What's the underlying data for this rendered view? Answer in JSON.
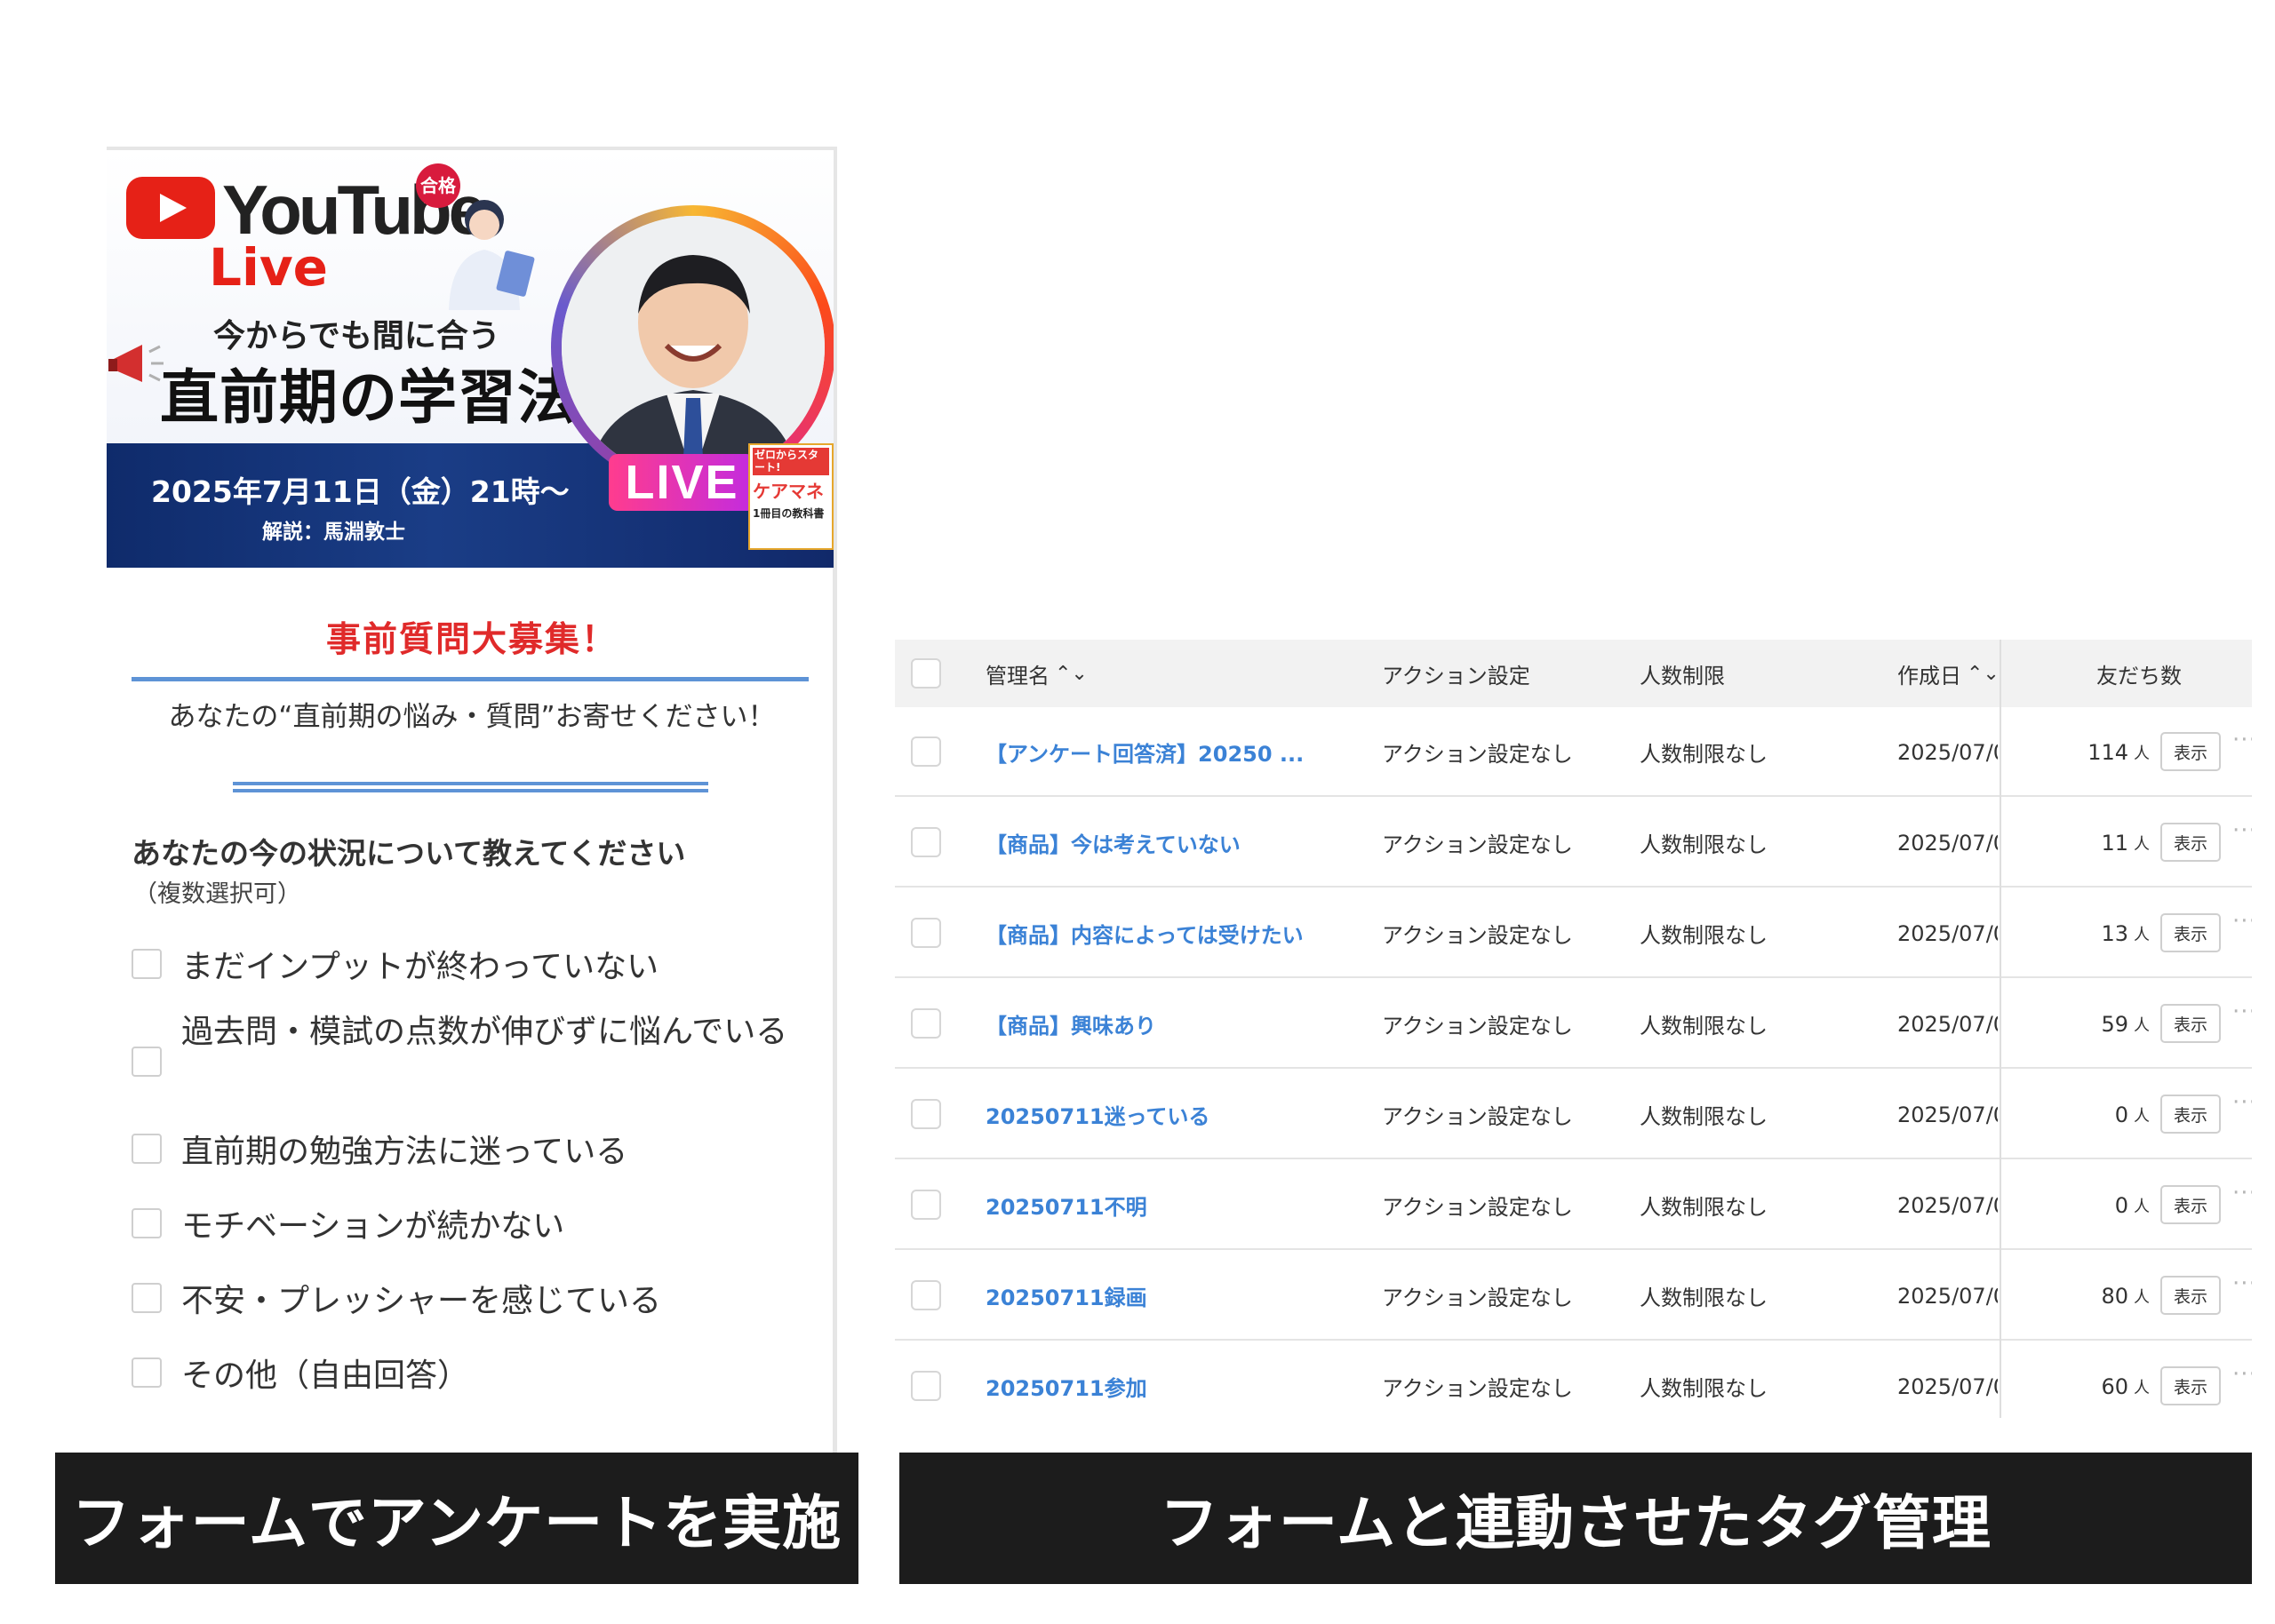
{
  "form": {
    "banner": {
      "youtube_word": "YouTube",
      "live_word": "Live",
      "pass_badge": "合格",
      "tagline": "今からでも間に合う",
      "headline": "直前期の学習法",
      "date": "2025年7月11日（金）21時〜",
      "speaker": "解説：馬淵敦士",
      "live_badge": "LIVE",
      "book_tag": "ゼロからスタート!",
      "book_title": "ケアマネ",
      "book_sub": "1冊目の教科書"
    },
    "section_title": "事前質問大募集！",
    "subtitle": "あなたの“直前期の悩み・質問”お寄せください！",
    "question": "あなたの今の状況について教えてください",
    "question_note": "（複数選択可）",
    "options": [
      "まだインプットが終わっていない",
      "過去問・模試の点数が伸びずに悩んでいる",
      "直前期の勉強方法に迷っている",
      "モチベーションが続かない",
      "不安・プレッシャーを感じている",
      "その他（自由回答）"
    ]
  },
  "captions": {
    "left": "フォームでアンケートを実施",
    "right": "フォームと連動させたタグ管理"
  },
  "table": {
    "headers": {
      "name": "管理名",
      "action": "アクション設定",
      "limit": "人数制限",
      "created": "作成日",
      "friends": "友だち数",
      "sort_icon": "⌃⌄"
    },
    "unit": "人",
    "show_label": "表示",
    "more_icon": "···",
    "rows": [
      {
        "name": "【アンケート回答済】20250 ...",
        "action": "アクション設定なし",
        "limit": "人数制限なし",
        "created": "2025/07/0",
        "count": "114"
      },
      {
        "name": "【商品】今は考えていない",
        "action": "アクション設定なし",
        "limit": "人数制限なし",
        "created": "2025/07/0",
        "count": "11"
      },
      {
        "name": "【商品】内容によっては受けたい",
        "action": "アクション設定なし",
        "limit": "人数制限なし",
        "created": "2025/07/0",
        "count": "13"
      },
      {
        "name": "【商品】興味あり",
        "action": "アクション設定なし",
        "limit": "人数制限なし",
        "created": "2025/07/0",
        "count": "59"
      },
      {
        "name": "20250711迷っている",
        "action": "アクション設定なし",
        "limit": "人数制限なし",
        "created": "2025/07/0",
        "count": "0"
      },
      {
        "name": "20250711不明",
        "action": "アクション設定なし",
        "limit": "人数制限なし",
        "created": "2025/07/0",
        "count": "0"
      },
      {
        "name": "20250711録画",
        "action": "アクション設定なし",
        "limit": "人数制限なし",
        "created": "2025/07/0",
        "count": "80"
      },
      {
        "name": "20250711参加",
        "action": "アクション設定なし",
        "limit": "人数制限なし",
        "created": "2025/07/0",
        "count": "60"
      }
    ]
  },
  "colors": {
    "accent_blue": "#3b82d6",
    "rule_blue": "#5e93d6",
    "title_red": "#e02a2a",
    "youtube_red": "#e62117",
    "caption_bg": "#1c1c1c"
  }
}
